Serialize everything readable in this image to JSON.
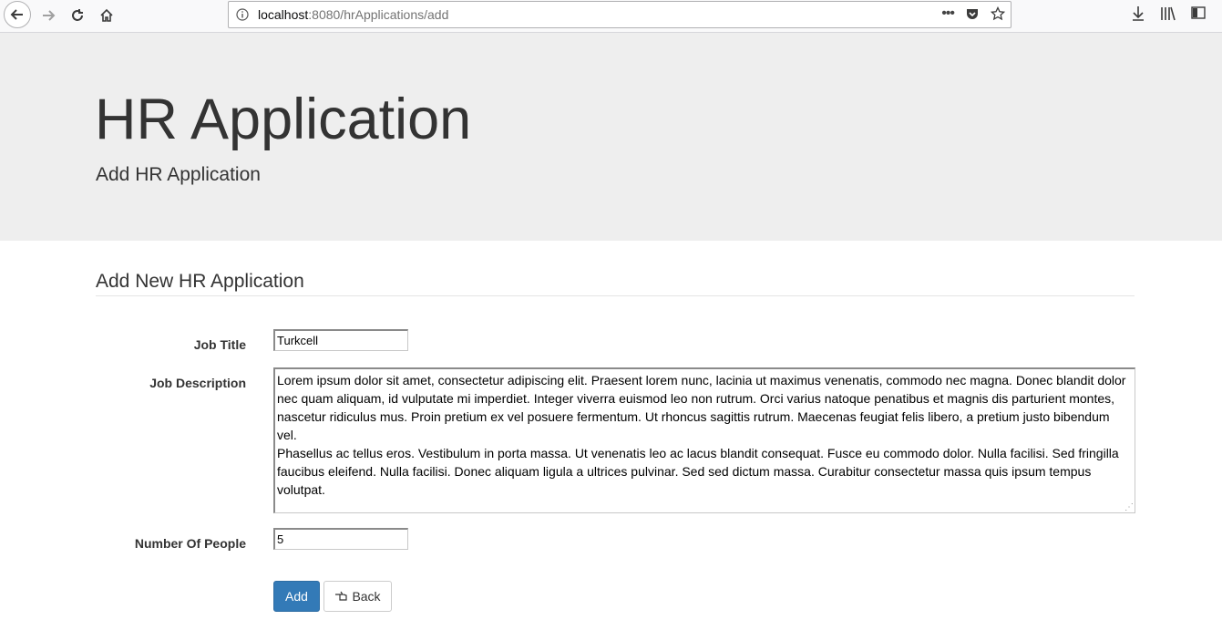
{
  "browser": {
    "url_host": "localhost",
    "url_rest": ":8080/hrApplications/add",
    "icons": [
      "back-icon",
      "forward-icon",
      "reload-icon",
      "home-icon",
      "info-icon",
      "more-icon",
      "pocket-icon",
      "star-icon",
      "download-icon",
      "library-icon",
      "sidebar-icon"
    ]
  },
  "jumbotron": {
    "title": "HR Application",
    "subtitle": "Add HR Application"
  },
  "form": {
    "section_title": "Add New HR Application",
    "job_title_label": "Job Title",
    "job_title_value": "Turkcell",
    "job_description_label": "Job Description",
    "job_description_value": "Lorem ipsum dolor sit amet, consectetur adipiscing elit. Praesent lorem nunc, lacinia ut maximus venenatis, commodo nec magna. Donec blandit dolor nec quam aliquam, id vulputate mi imperdiet. Integer viverra euismod leo non rutrum. Orci varius natoque penatibus et magnis dis parturient montes, nascetur ridiculus mus. Proin pretium ex vel posuere fermentum. Ut rhoncus sagittis rutrum. Maecenas feugiat felis libero, a pretium justo bibendum vel.\nPhasellus ac tellus eros. Vestibulum in porta massa. Ut venenatis leo ac lacus blandit consequat. Fusce eu commodo dolor. Nulla facilisi. Sed fringilla faucibus eleifend. Nulla facilisi. Donec aliquam ligula a ultrices pulvinar. Sed sed dictum massa. Curabitur consectetur massa quis ipsum tempus volutpat.",
    "number_of_people_label": "Number Of People",
    "number_of_people_value": "5",
    "add_button": "Add",
    "back_button": "Back"
  },
  "colors": {
    "jumbotron_bg": "#eeeeee",
    "primary": "#337ab7"
  }
}
